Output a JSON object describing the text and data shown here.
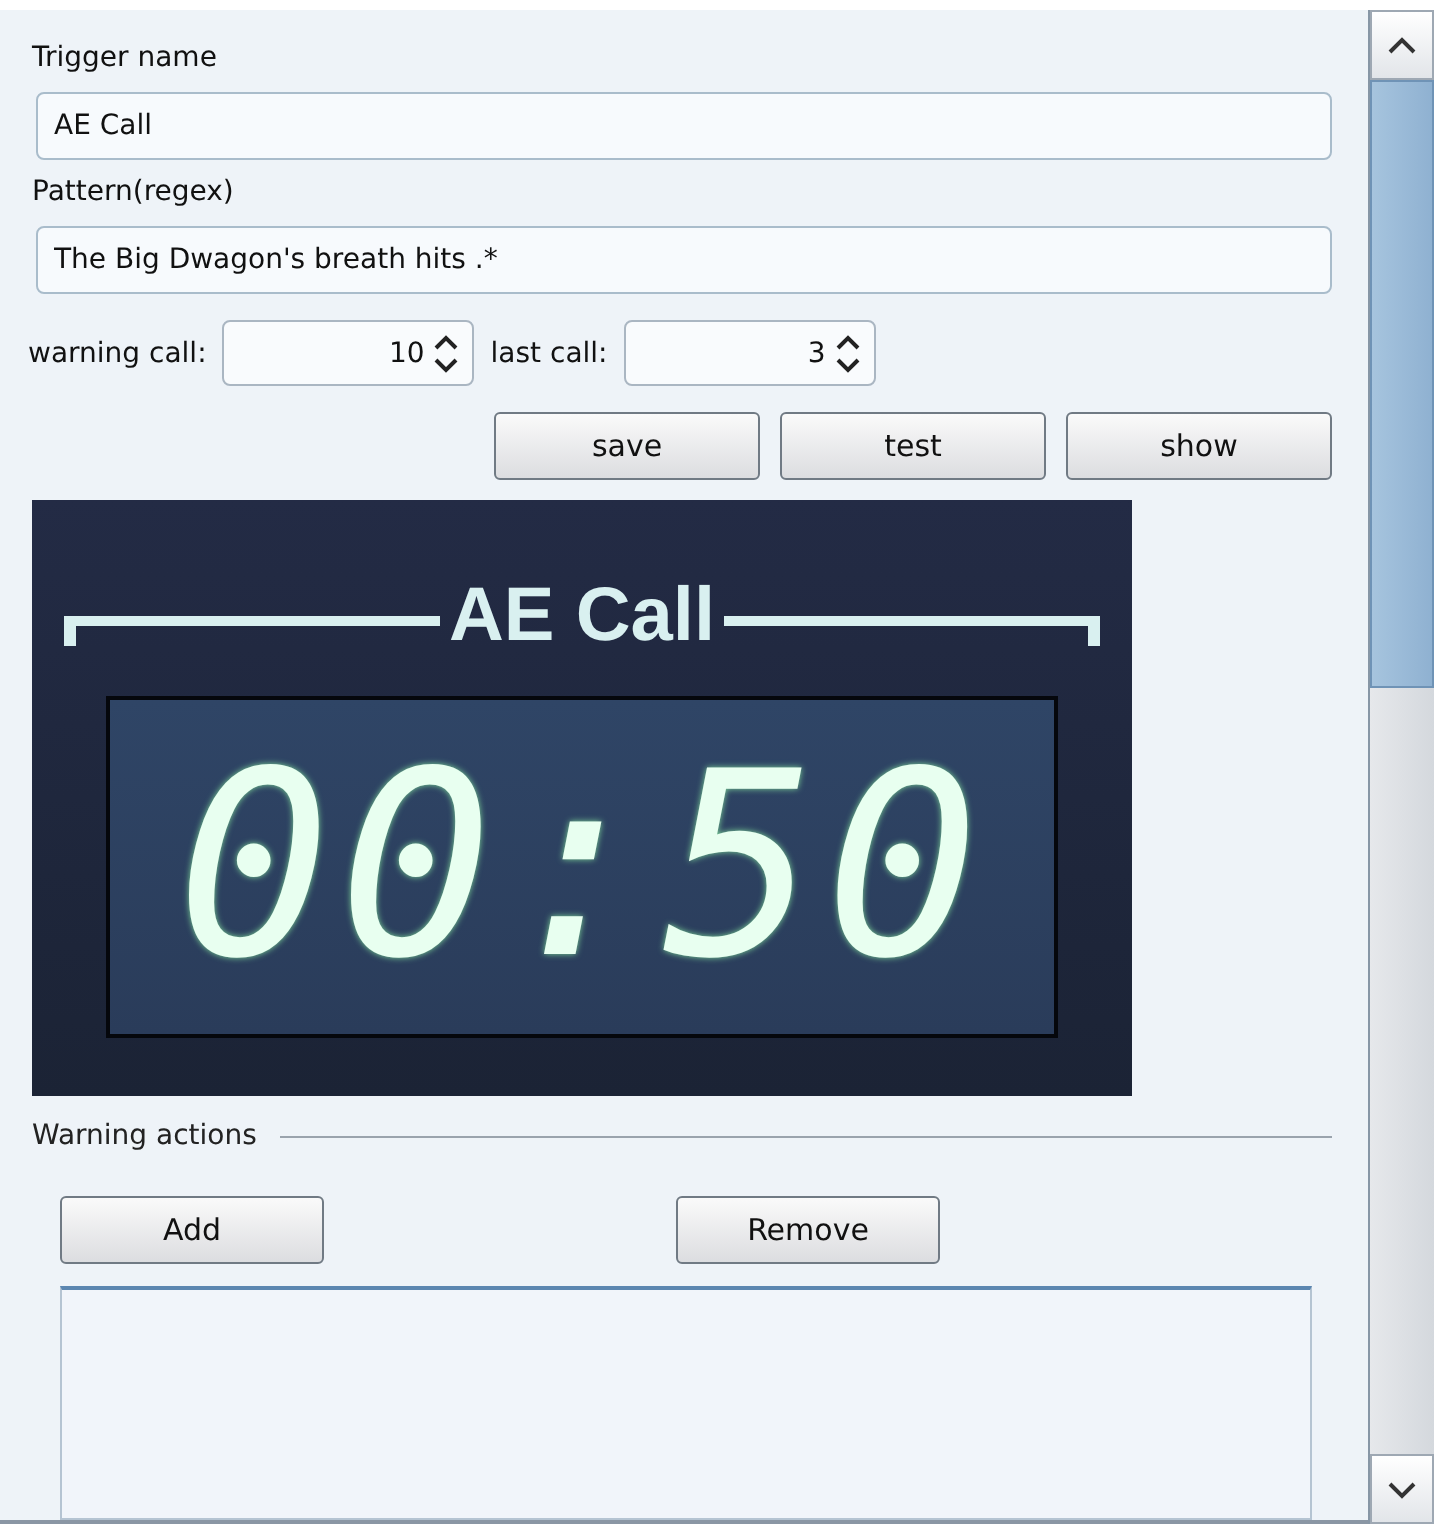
{
  "trigger_name": {
    "label": "Trigger name",
    "value": "AE Call"
  },
  "pattern": {
    "label": "Pattern(regex)",
    "value": "The Big Dwagon's breath hits .*"
  },
  "spinners": [
    {
      "label": "warning call:",
      "value": "10"
    },
    {
      "label": "last call:",
      "value": "3"
    }
  ],
  "buttons": [
    "save",
    "test",
    "show"
  ],
  "display": {
    "title": "AE Call",
    "time": "00:50"
  },
  "warning_actions": {
    "title": "Warning actions",
    "buttons": [
      "Add",
      "Remove"
    ]
  }
}
